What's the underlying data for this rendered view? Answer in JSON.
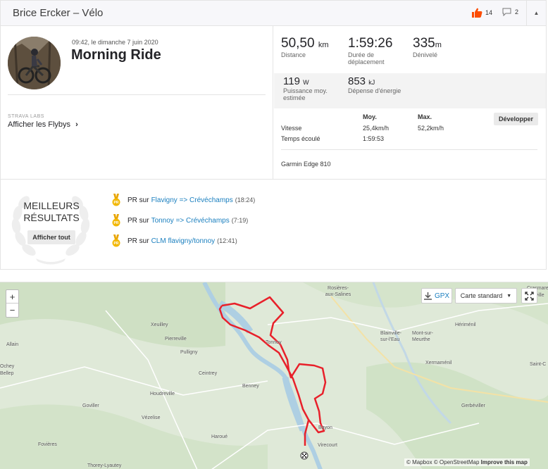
{
  "header": {
    "title": "Brice Ercker – Vélo",
    "kudos_count": "14",
    "comments_count": "2"
  },
  "activity": {
    "date": "09:42, le dimanche 7 juin 2020",
    "name": "Morning Ride",
    "labs_label": "STRAVA LABS",
    "flyby_link": "Afficher les Flybys"
  },
  "stats": {
    "distance": {
      "value": "50,50",
      "unit": "km",
      "label": "Distance"
    },
    "moving_time": {
      "value": "1:59:26",
      "label": "Durée de déplacement"
    },
    "elevation": {
      "value": "335",
      "unit": "m",
      "label": "Dénivelé"
    },
    "power": {
      "value": "119",
      "unit": "W",
      "label": "Puissance moy. estimée"
    },
    "energy": {
      "value": "853",
      "unit": "kJ",
      "label": "Dépense d'énergie"
    }
  },
  "details_table": {
    "col_avg": "Moy.",
    "col_max": "Max.",
    "expand_button": "Développer",
    "rows": [
      {
        "label": "Vitesse",
        "avg": "25,4km/h",
        "max": "52,2km/h"
      },
      {
        "label": "Temps écoulé",
        "avg": "1:59:53",
        "max": ""
      }
    ],
    "device": "Garmin Edge 810"
  },
  "best_results": {
    "title_line1": "MEILLEURS",
    "title_line2": "RÉSULTATS",
    "show_all": "Afficher tout",
    "items": [
      {
        "prefix": "PR sur",
        "segment": "Flavigny => Crévéchamps",
        "time": "(18:24)"
      },
      {
        "prefix": "PR sur",
        "segment": "Tonnoy => Crévéchamps",
        "time": "(7:19)"
      },
      {
        "prefix": "PR sur",
        "segment": "CLM flavigny/tonnoy",
        "time": "(12:41)"
      }
    ]
  },
  "map": {
    "zoom_in": "+",
    "zoom_out": "−",
    "gpx_label": "GPX",
    "map_type": "Carte standard",
    "attribution_mapbox": "© Mapbox",
    "attribution_osm": "© OpenStreetMap",
    "improve_link": "Improve this map",
    "places": [
      "Rosières-aux-Salines",
      "Xeuilley",
      "Pierreville",
      "Pulligny",
      "Tonnoy",
      "Blainville-sur-l'Eau",
      "Mont-sur-Meurthe",
      "Hériménil",
      "Xermaménil",
      "Saint-C",
      "Allain",
      "Ceintrey",
      "Benney",
      "Houdreville",
      "Goviller",
      "Vézelise",
      "Gerbéviller",
      "Haroué",
      "Bayon",
      "Virecourt",
      "Fovières",
      "Crasmare",
      "Lunéville",
      "Thorey-Lyautey",
      "Ochey",
      "Bellep"
    ]
  },
  "colors": {
    "route": "#e8202a",
    "link": "#1a7fbf",
    "kudos": "#fc4c02",
    "medal": "#f2b807"
  }
}
